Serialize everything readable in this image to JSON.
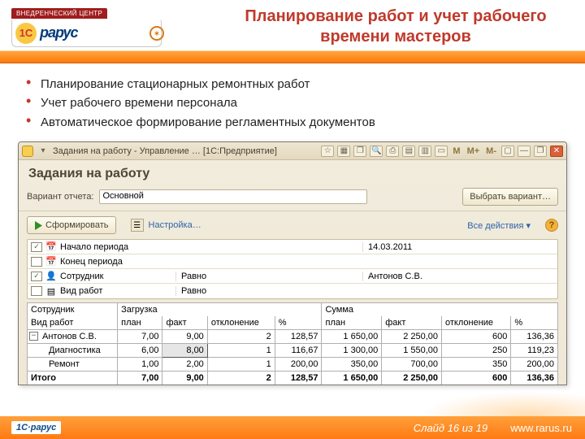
{
  "logo": {
    "badge": "ВНЕДРЕНЧЕСКИЙ ЦЕНТР",
    "one_c": "1C",
    "name": "рарус"
  },
  "title": "Планирование работ и учет рабочего времени мастеров",
  "bullets": [
    "Планирование стационарных ремонтных работ",
    "Учет рабочего времени персонала",
    "Автоматическое формирование регламентных документов"
  ],
  "win": {
    "title": "Задания на работу - Управление …   [1С:Предприятие]",
    "m_labels": [
      "M",
      "M+",
      "M-"
    ],
    "report_title": "Задания на работу",
    "variant_label": "Вариант отчета:",
    "variant_value": "Основной",
    "choose_variant": "Выбрать вариант…",
    "form_btn": "Сформировать",
    "settings_link": "Настройка…",
    "all_actions": "Все действия ▾",
    "help": "?",
    "filters": [
      {
        "checked": true,
        "label": "Начало периода",
        "op": "",
        "val": "14.03.2011"
      },
      {
        "checked": false,
        "label": "Конец периода",
        "op": "",
        "val": ""
      },
      {
        "checked": true,
        "label": "Сотрудник",
        "op": "Равно",
        "val": "Антонов С.В."
      },
      {
        "checked": false,
        "label": "Вид работ",
        "op": "Равно",
        "val": ""
      }
    ],
    "table": {
      "top": {
        "col0": "Сотрудник",
        "loadGroup": "Загрузка",
        "sumGroup": "Сумма"
      },
      "sub": {
        "col0": "Вид работ",
        "load": [
          "план",
          "факт",
          "отклонение",
          "%"
        ],
        "sum": [
          "план",
          "факт",
          "отклонение",
          "%"
        ]
      },
      "rows": [
        {
          "kind": "group",
          "name": "Антонов С.В.",
          "load": [
            "7,00",
            "9,00",
            "2",
            "128,57"
          ],
          "sum": [
            "1 650,00",
            "2 250,00",
            "600",
            "136,36"
          ]
        },
        {
          "kind": "child",
          "name": "Диагностика",
          "load": [
            "6,00",
            "8,00",
            "1",
            "116,67"
          ],
          "sum": [
            "1 300,00",
            "1 550,00",
            "250",
            "119,23"
          ]
        },
        {
          "kind": "child",
          "name": "Ремонт",
          "load": [
            "1,00",
            "2,00",
            "1",
            "200,00"
          ],
          "sum": [
            "350,00",
            "700,00",
            "350",
            "200,00"
          ]
        },
        {
          "kind": "total",
          "name": "Итого",
          "load": [
            "7,00",
            "9,00",
            "2",
            "128,57"
          ],
          "sum": [
            "1 650,00",
            "2 250,00",
            "600",
            "136,36"
          ]
        }
      ]
    }
  },
  "footer": {
    "logo": "1С·рарус",
    "slide_label_a": "Слайд ",
    "cur": "16",
    "slide_label_b": " из  ",
    "total": "19",
    "site": "www.rarus.ru"
  }
}
